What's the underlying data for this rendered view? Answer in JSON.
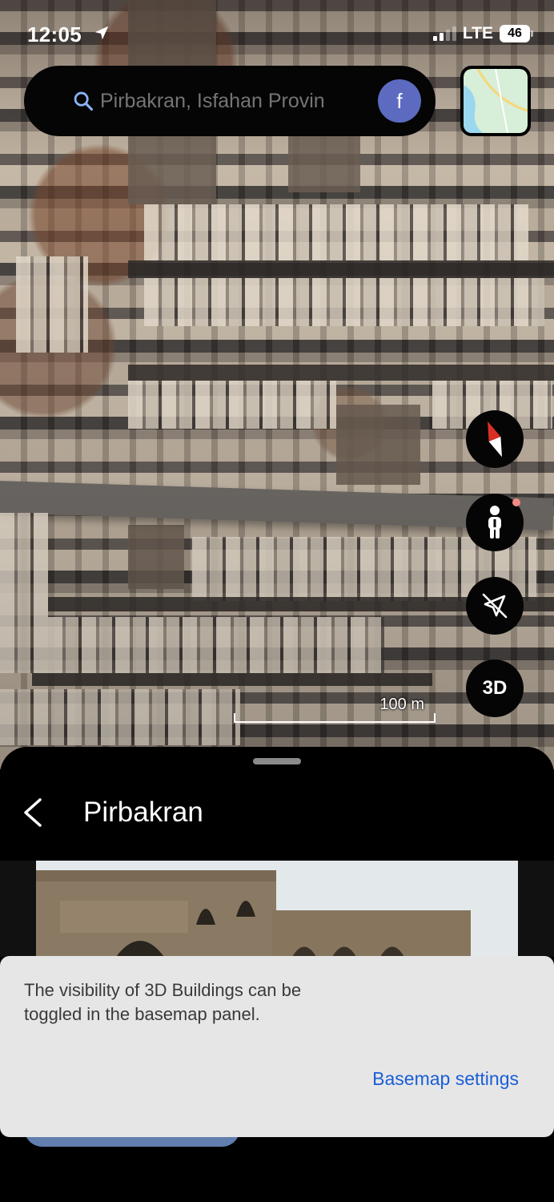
{
  "status_bar": {
    "time": "12:05",
    "network": "LTE",
    "battery": "46"
  },
  "search": {
    "placeholder": "Pirbakran, Isfahan Provin",
    "account_initial": "f"
  },
  "map": {
    "scale_label": "100 m",
    "controls": {
      "threed_label": "3D"
    }
  },
  "place": {
    "title": "Pirbakran"
  },
  "snackbar": {
    "message": "The visibility of 3D Buildings can be toggled in the basemap panel.",
    "action_label": "Basemap settings"
  },
  "colors": {
    "accent_link": "#1a5ed6",
    "avatar_bg": "#5c6bc0",
    "compass_red": "#d93025"
  },
  "icons": {
    "search": "search-icon",
    "location_arrow": "location-arrow-icon",
    "compass": "compass-icon",
    "pegman": "pegman-icon",
    "navigation_off": "navigation-off-icon",
    "back": "chevron-left-icon"
  }
}
